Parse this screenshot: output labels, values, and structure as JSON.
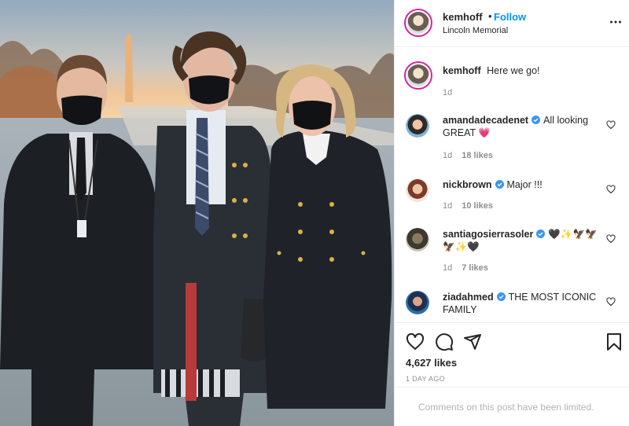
{
  "header": {
    "username": "kemhoff",
    "separator": "•",
    "follow_label": "Follow",
    "location": "Lincoln Memorial",
    "more_icon": "more-horizontal-icon"
  },
  "caption": {
    "username": "kemhoff",
    "text": "Here we go!",
    "age": "1d"
  },
  "comments": [
    {
      "username": "amandadecadenet",
      "verified": true,
      "text": "All looking GREAT 💗",
      "age": "1d",
      "likes": "18 likes"
    },
    {
      "username": "nickbrown",
      "verified": true,
      "text": "Major !!!",
      "age": "1d",
      "likes": "10 likes"
    },
    {
      "username": "santiagosierrasoler",
      "verified": true,
      "text": "🖤✨🦅🦅🦅✨🖤",
      "age": "1d",
      "likes": "7 likes"
    },
    {
      "username": "ziadahmed",
      "verified": true,
      "text": "THE MOST ICONIC FAMILY"
    }
  ],
  "actions": {
    "likes_count": "4,627 likes",
    "date": "1 DAY AGO",
    "icons": [
      "heart-icon",
      "comment-icon",
      "share-icon",
      "bookmark-icon"
    ]
  },
  "comments_limited_text": "Comments on this post have been limited.",
  "colors": {
    "follow_blue": "#0095f6",
    "verified_blue": "#3897f0",
    "text_primary": "#262626",
    "text_secondary": "#8e8e8e",
    "border": "#efefef"
  }
}
